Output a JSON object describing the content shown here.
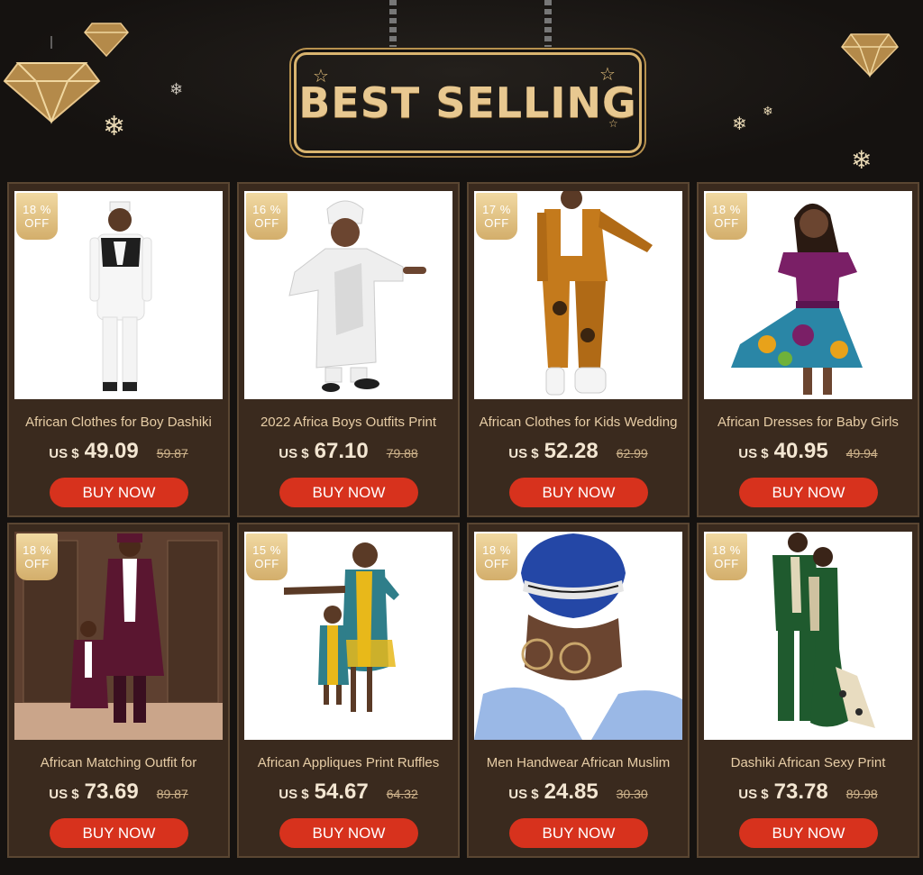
{
  "banner": {
    "title": "BEST SELLING"
  },
  "products": [
    {
      "discount_pct": "18 %",
      "discount_word": "OFF",
      "title": "African Clothes for Boy Dashiki",
      "currency": "US $",
      "price": "49.09",
      "old_price": "59.87",
      "button": "BUY NOW"
    },
    {
      "discount_pct": "16 %",
      "discount_word": "OFF",
      "title": "2022 Africa Boys Outfits Print",
      "currency": "US $",
      "price": "67.10",
      "old_price": "79.88",
      "button": "BUY NOW"
    },
    {
      "discount_pct": "17 %",
      "discount_word": "OFF",
      "title": "African Clothes for Kids Wedding",
      "currency": "US $",
      "price": "52.28",
      "old_price": "62.99",
      "button": "BUY NOW"
    },
    {
      "discount_pct": "18 %",
      "discount_word": "OFF",
      "title": "African Dresses for Baby Girls",
      "currency": "US $",
      "price": "40.95",
      "old_price": "49.94",
      "button": "BUY NOW"
    },
    {
      "discount_pct": "18 %",
      "discount_word": "OFF",
      "title": "African Matching Outfit for",
      "currency": "US $",
      "price": "73.69",
      "old_price": "89.87",
      "button": "BUY NOW"
    },
    {
      "discount_pct": "15 %",
      "discount_word": "OFF",
      "title": "African Appliques Print Ruffles",
      "currency": "US $",
      "price": "54.67",
      "old_price": "64.32",
      "button": "BUY NOW"
    },
    {
      "discount_pct": "18 %",
      "discount_word": "OFF",
      "title": "Men Handwear African Muslim",
      "currency": "US $",
      "price": "24.85",
      "old_price": "30.30",
      "button": "BUY NOW"
    },
    {
      "discount_pct": "18 %",
      "discount_word": "OFF",
      "title": "Dashiki African Sexy Print",
      "currency": "US $",
      "price": "73.78",
      "old_price": "89.98",
      "button": "BUY NOW"
    }
  ],
  "colors": {
    "background": "#151210",
    "card": "#3a2a1e",
    "gold": "#e8c890",
    "button": "#d7321d"
  }
}
